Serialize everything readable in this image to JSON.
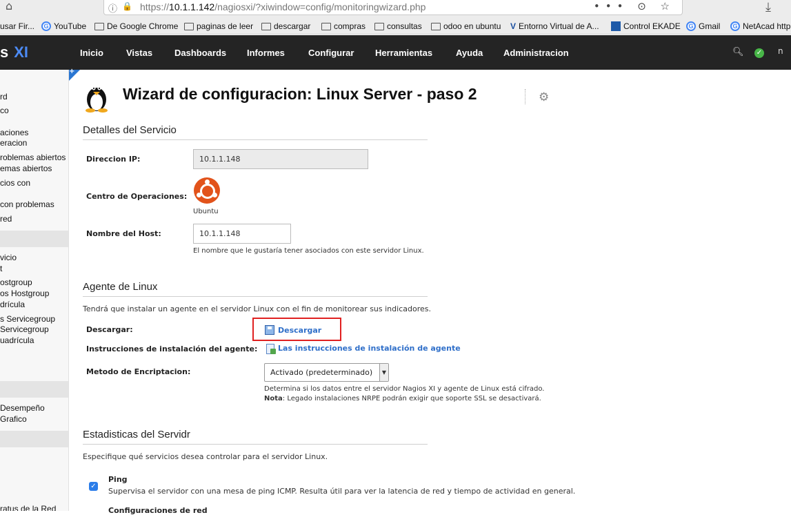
{
  "browser": {
    "url_prefix": "https://",
    "url_host": "10.1.1.142",
    "url_path": "/nagiosxi/?xiwindow=config/monitoringwizard.php",
    "actions": "••• ⊙ ☆"
  },
  "bookmarks": [
    {
      "label": "usar Fir...",
      "icon": "none"
    },
    {
      "label": "YouTube",
      "icon": "google-icon"
    },
    {
      "label": "De Google Chrome",
      "icon": "folder-icon"
    },
    {
      "label": "paginas de leer",
      "icon": "folder-icon"
    },
    {
      "label": "descargar",
      "icon": "folder-icon"
    },
    {
      "label": "compras",
      "icon": "folder-icon"
    },
    {
      "label": "consultas",
      "icon": "folder-icon"
    },
    {
      "label": "odoo en ubuntu",
      "icon": "folder-icon"
    },
    {
      "label": "Entorno Virtual de A...",
      "icon": "v-icon"
    },
    {
      "label": "Control EKADE",
      "icon": "ekade-icon"
    },
    {
      "label": "Gmail",
      "icon": "google-icon"
    },
    {
      "label": "NetAcad http",
      "icon": "google-icon"
    }
  ],
  "navbar": {
    "logo_left": "s",
    "logo_xi": "XI",
    "items": [
      "Inicio",
      "Vistas",
      "Dashboards",
      "Informes",
      "Configurar",
      "Herramientas",
      "Ayuda",
      "Administracion"
    ],
    "user_initial": "n"
  },
  "sidebar": {
    "items": [
      "rd",
      "co",
      "aciones",
      "eracion",
      "roblemas abiertos",
      "emas abiertos",
      "cios con",
      "con problemas",
      "red",
      "vicio",
      "t",
      "ostgroup",
      "os Hostgroup",
      "drícula",
      "s Servicegroup",
      "Servicegroup",
      "uadrícula",
      "Desempeño",
      "Grafico",
      "ratus de la Red"
    ]
  },
  "page": {
    "title": "Wizard de configuracion: Linux Server - paso 2",
    "service_details": {
      "heading": "Detalles del Servicio",
      "ip_label": "Direccion IP:",
      "ip_value": "10.1.1.148",
      "ops_center_label": "Centro de Operaciones:",
      "os_name": "Ubuntu",
      "hostname_label": "Nombre del Host:",
      "hostname_value": "10.1.1.148",
      "hostname_help": "El nombre que le gustaría tener asociados con este servidor Linux."
    },
    "agent": {
      "heading": "Agente de Linux",
      "intro": "Tendrá que instalar un agente en el servidor Linux con el fin de monitorear sus indicadores.",
      "download_label": "Descargar:",
      "download_link": "Descargar",
      "instructions_label": "Instrucciones de instalación del agente:",
      "instructions_link": "Las instrucciones de instalación de agente",
      "encryption_label": "Metodo de Encriptacion:",
      "encryption_value": "Activado (predeterminado)",
      "encryption_help": "Determina si los datos entre el servidor Nagios XI y agente de Linux está cifrado.",
      "note_bold": "Nota",
      "note_text": ": Legado instalaciones NRPE podrán exigir que soporte SSL se desactivará."
    },
    "stats": {
      "heading": "Estadisticas del Servidr",
      "intro": "Especifique qué servicios desea controlar para el servidor Linux.",
      "ping_title": "Ping",
      "ping_checked": true,
      "ping_desc": "Supervisa el servidor con una mesa de ping ICMP. Resulta útil para ver la latencia de red y tiempo de actividad en general.",
      "next_title": "Configuraciones de red"
    }
  }
}
